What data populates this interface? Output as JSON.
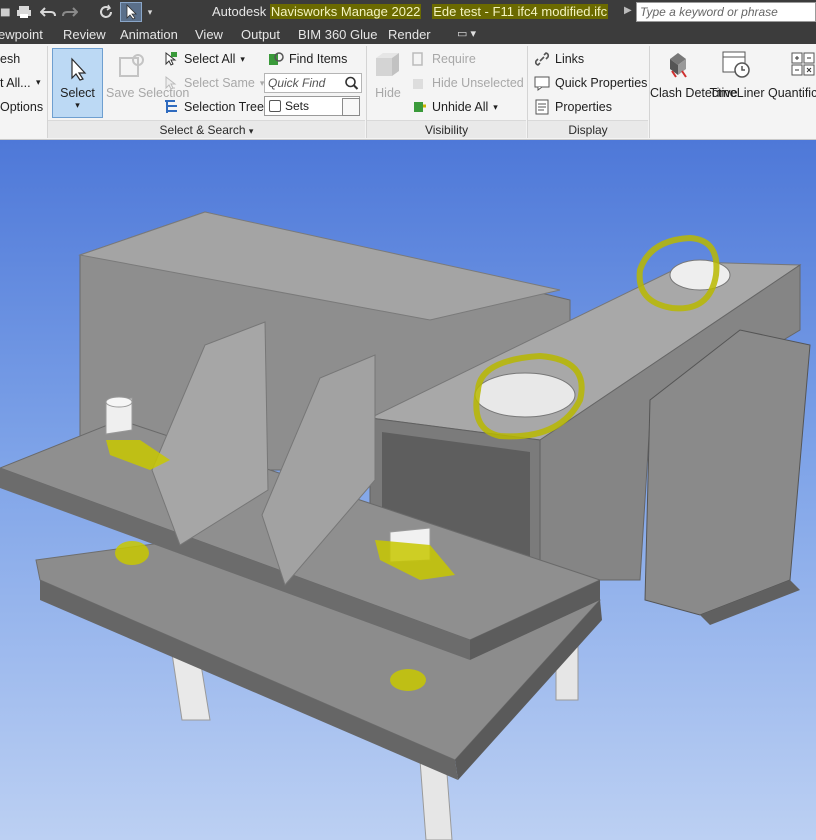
{
  "app": {
    "brand": "Autodesk",
    "product": "Navisworks Manage 2022",
    "file_name": "Ede test - F11 ifc4 modified.ifc",
    "search_placeholder": "Type a keyword or phrase"
  },
  "tabs": [
    "ewpoint",
    "Review",
    "Animation",
    "View",
    "Output",
    "BIM 360 Glue",
    "Render"
  ],
  "ribbon": {
    "left_cut": [
      "esh",
      "t All...",
      "Options"
    ],
    "select_label": "Select",
    "save_selection_label": "Save Selection",
    "select_all": "Select All",
    "select_same": "Select Same",
    "selection_tree": "Selection Tree",
    "find_items": "Find Items",
    "quick_find_placeholder": "Quick Find",
    "sets_label": "Sets",
    "select_search_footer": "Select & Search",
    "hide": "Hide",
    "require": "Require",
    "hide_unselected": "Hide Unselected",
    "unhide_all": "Unhide All",
    "visibility_footer": "Visibility",
    "links": "Links",
    "quick_properties": "Quick Properties",
    "properties": "Properties",
    "display_footer": "Display",
    "clash_detective": "Clash Detective",
    "timeliner": "TimeLiner",
    "quantification": "Quantific"
  },
  "colors": {
    "highlight_marker": "#b8b800",
    "model_grey": "#8a8a8a",
    "select_active": "#bcd9f4"
  }
}
